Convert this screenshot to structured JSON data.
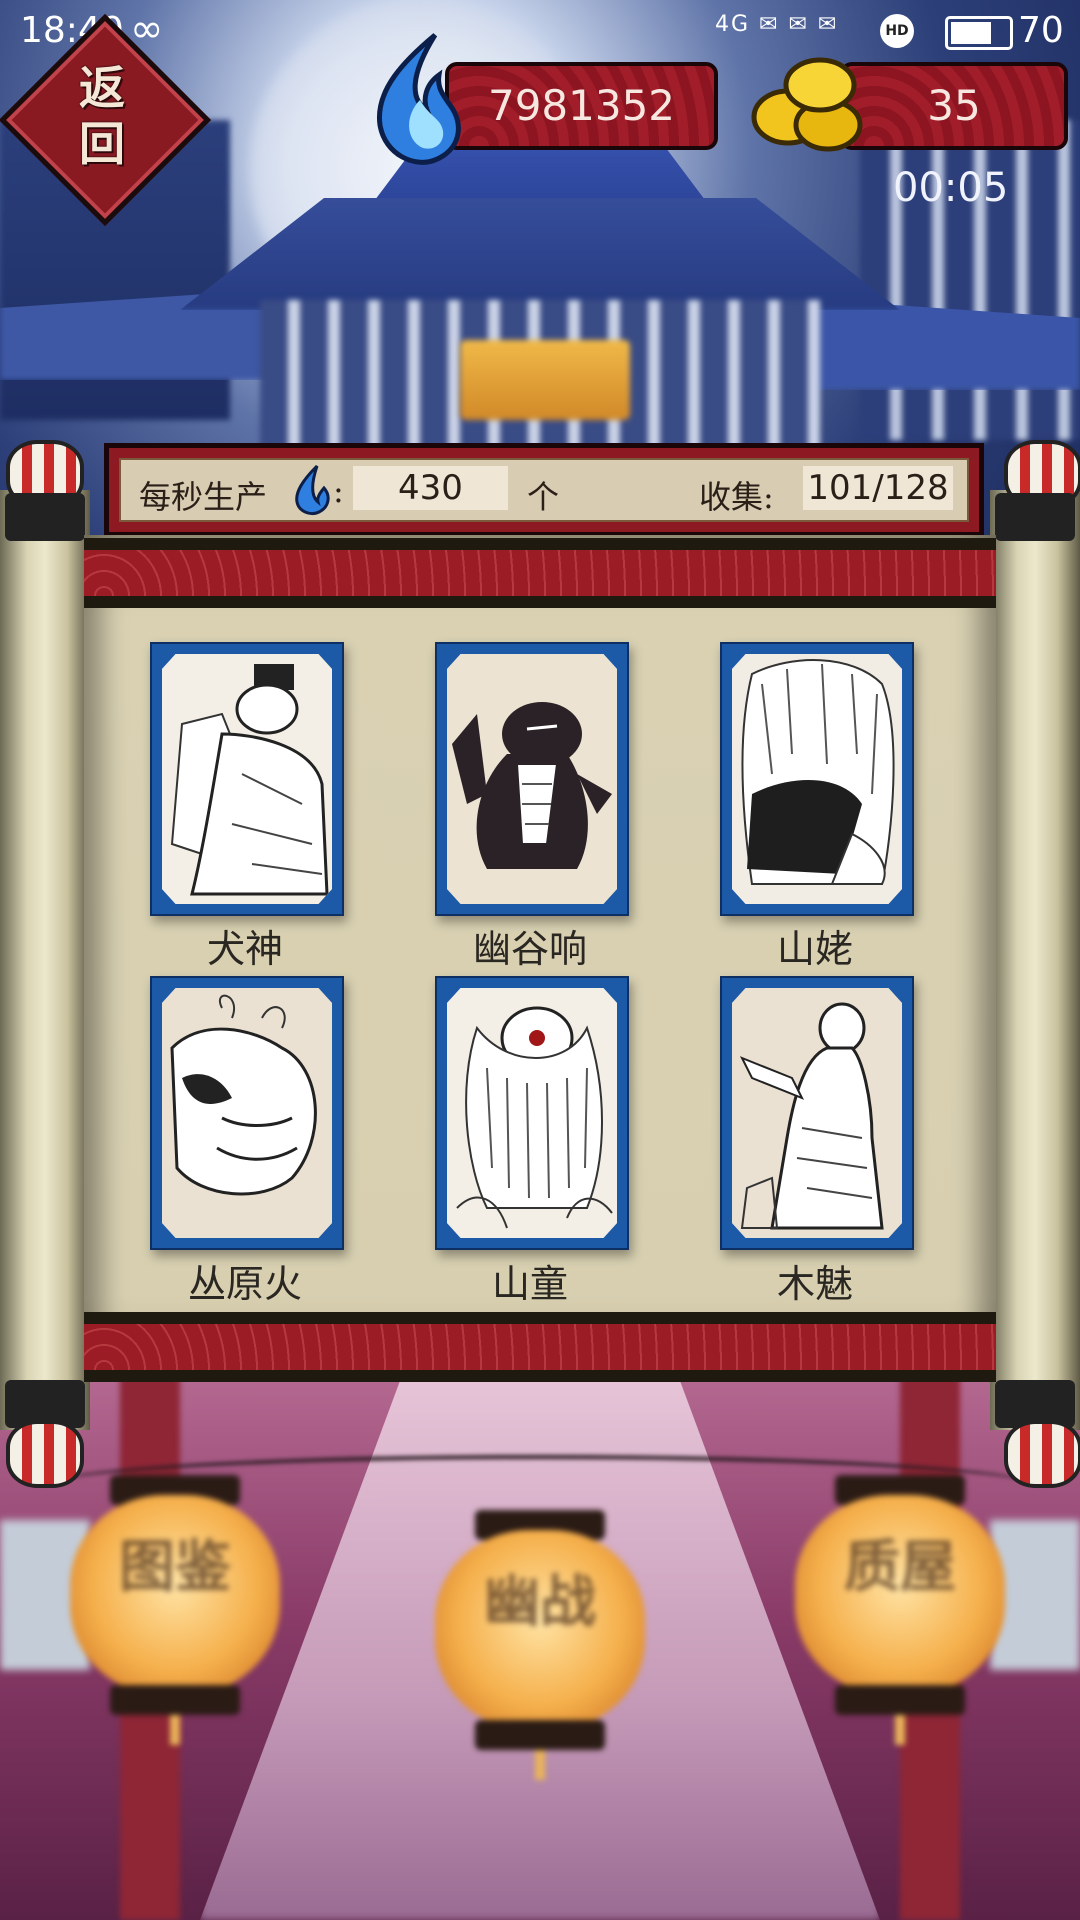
{
  "status_bar": {
    "time": "18:40",
    "loop_symbol": "∞",
    "network_label": "4G",
    "hd_label": "HD",
    "battery": "70"
  },
  "header": {
    "back_label": "返\n回",
    "soul_fire_count": "7981352",
    "coin_count": "35",
    "timer": "00:05"
  },
  "info": {
    "rate_label": "每秒生产",
    "rate_separator": ":",
    "rate_value": "430",
    "rate_unit": "个",
    "collect_label": "收集:",
    "collect_value": "101/128"
  },
  "cards": [
    {
      "name": "犬神",
      "icon": "inugami-portrait"
    },
    {
      "name": "幽谷响",
      "icon": "yamabiko-portrait"
    },
    {
      "name": "山姥",
      "icon": "yamauba-portrait"
    },
    {
      "name": "丛原火",
      "icon": "sougenbi-portrait"
    },
    {
      "name": "山童",
      "icon": "yamawaro-portrait"
    },
    {
      "name": "木魅",
      "icon": "kodama-portrait"
    }
  ],
  "lanterns": [
    {
      "label": "图鉴"
    },
    {
      "label": "幽战"
    },
    {
      "label": "质屋"
    }
  ],
  "colors": {
    "card_frame": "#1c5aa8",
    "banner_red": "#8d1a22",
    "paper": "#d7cfb0"
  }
}
